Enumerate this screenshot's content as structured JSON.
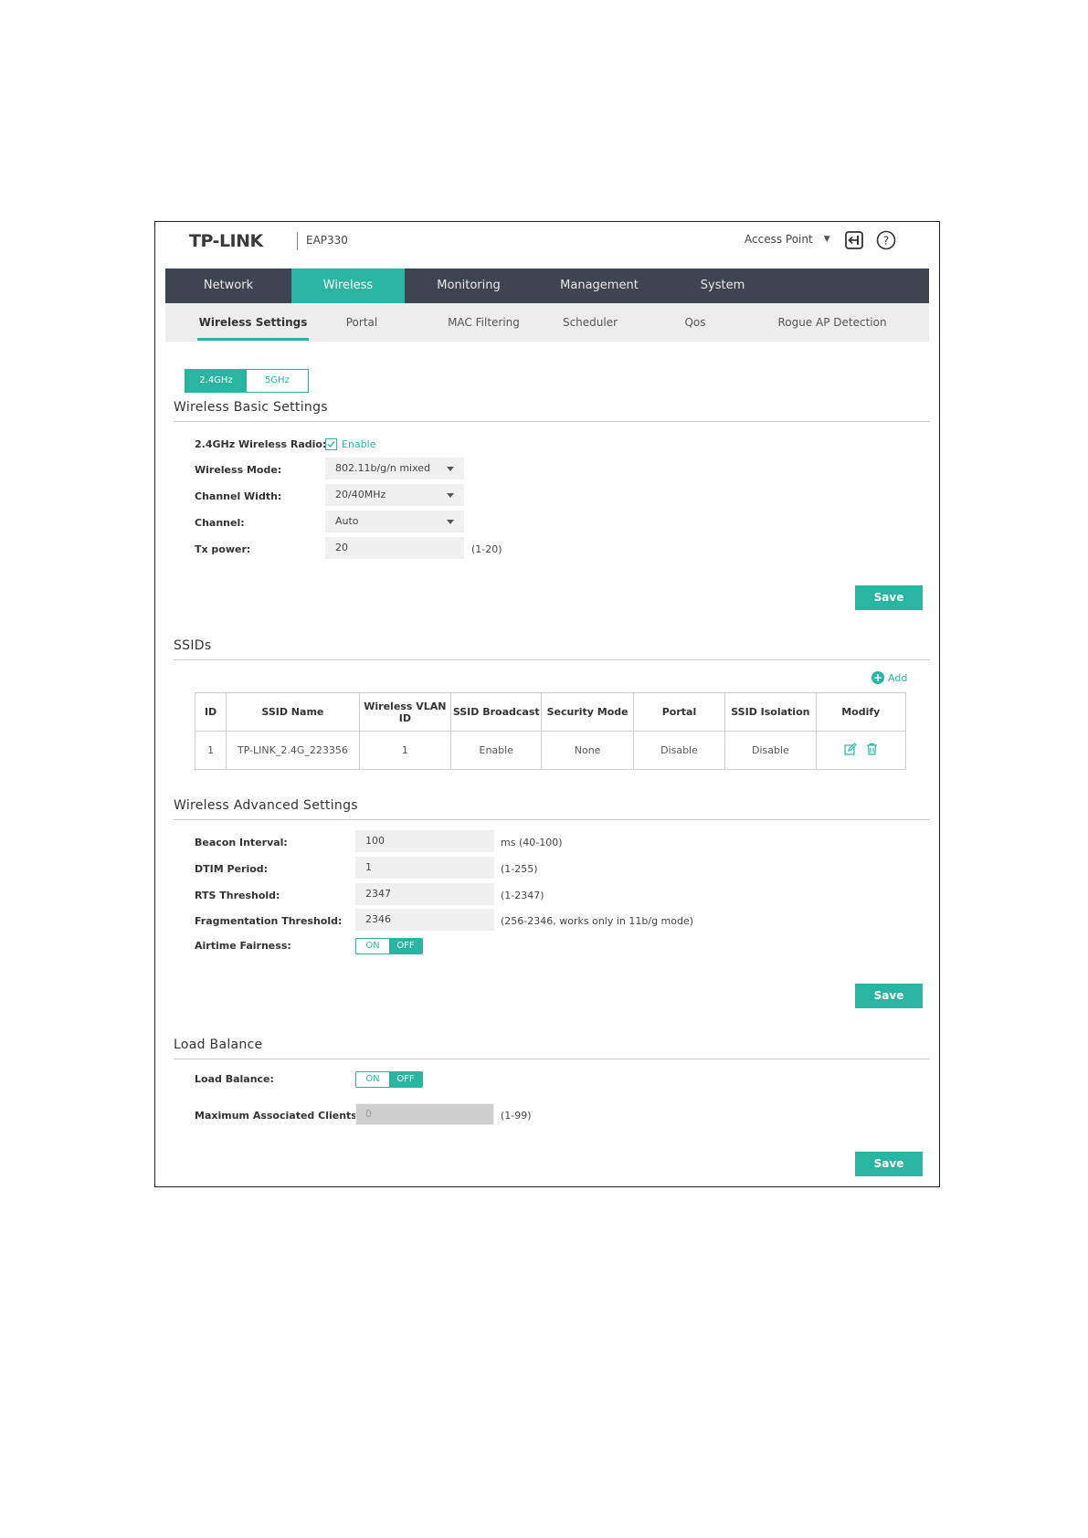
{
  "header": {
    "brand": "TP-LINK",
    "model": "EAP330",
    "mode": "Access Point"
  },
  "main_nav": [
    "Network",
    "Wireless",
    "Monitoring",
    "Management",
    "System"
  ],
  "sub_nav": [
    "Wireless Settings",
    "Portal",
    "MAC Filtering",
    "Scheduler",
    "Qos",
    "Rogue AP Detection"
  ],
  "band_tabs": [
    "2.4GHz",
    "5GHz"
  ],
  "basic": {
    "title": "Wireless Basic Settings",
    "radio_label": "2.4GHz Wireless Radio:",
    "radio_value": "Enable",
    "mode_label": "Wireless Mode:",
    "mode_value": "802.11b/g/n mixed",
    "width_label": "Channel Width:",
    "width_value": "20/40MHz",
    "channel_label": "Channel:",
    "channel_value": "Auto",
    "tx_label": "Tx power:",
    "tx_value": "20",
    "tx_hint": "(1-20)",
    "save": "Save"
  },
  "ssids": {
    "title": "SSIDs",
    "add_label": "Add",
    "columns": [
      "ID",
      "SSID Name",
      "Wireless VLAN ID",
      "SSID Broadcast",
      "Security Mode",
      "Portal",
      "SSID Isolation",
      "Modify"
    ],
    "rows": [
      [
        "1",
        "TP-LINK_2.4G_223356",
        "1",
        "Enable",
        "None",
        "Disable",
        "Disable"
      ]
    ]
  },
  "advanced": {
    "title": "Wireless Advanced Settings",
    "beacon_label": "Beacon Interval:",
    "beacon_value": "100",
    "beacon_hint": "ms (40-100)",
    "dtim_label": "DTIM Period:",
    "dtim_value": "1",
    "dtim_hint": "(1-255)",
    "rts_label": "RTS Threshold:",
    "rts_value": "2347",
    "rts_hint": "(1-2347)",
    "frag_label": "Fragmentation Threshold:",
    "frag_value": "2346",
    "frag_hint": "(256-2346, works only in 11b/g mode)",
    "airtime_label": "Airtime Fairness:",
    "toggle_on": "ON",
    "toggle_off": "OFF",
    "save": "Save"
  },
  "load_balance": {
    "title": "Load Balance",
    "lb_label": "Load Balance:",
    "toggle_on": "ON",
    "toggle_off": "OFF",
    "max_label": "Maximum Associated Clients:",
    "max_value": "0",
    "max_hint": "(1-99)",
    "save": "Save"
  },
  "colors": {
    "accent": "#29b5a1",
    "nav_bg": "#3f4550",
    "subnav_bg": "#ededed"
  }
}
